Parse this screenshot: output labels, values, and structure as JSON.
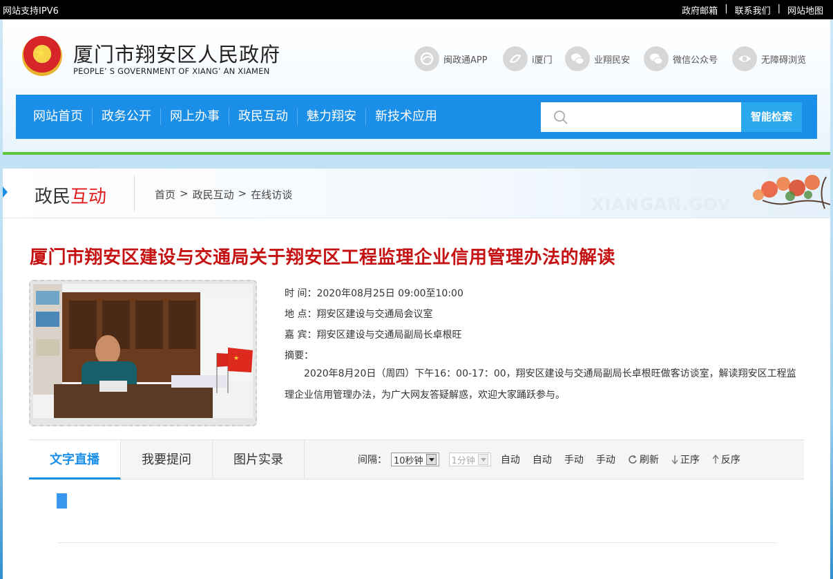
{
  "topbar": {
    "ipv6": "网站支持IPV6",
    "links": [
      "政府邮箱",
      "联系我们",
      "网站地图"
    ],
    "separator": "|"
  },
  "header": {
    "title": "厦门市翔安区人民政府",
    "subtitle": "PEOPLE’ S GOVERNMENT OF XIANG’ AN XIAMEN",
    "quick_links": [
      {
        "label": "闽政通APP",
        "icon": "minzhengtong-icon"
      },
      {
        "label": "i厦门",
        "icon": "ixiamen-icon"
      },
      {
        "label": "业翔民安",
        "icon": "wechat-icon"
      },
      {
        "label": "微信公众号",
        "icon": "wechat-icon"
      },
      {
        "label": "无障碍浏览",
        "icon": "eye-icon"
      }
    ]
  },
  "nav": {
    "items": [
      "网站首页",
      "政务公开",
      "网上办事",
      "政民互动",
      "魅力翔安",
      "新技术应用"
    ],
    "search_placeholder": "",
    "search_button": "智能检索"
  },
  "section": {
    "title_black": "政民",
    "title_red": "互动",
    "breadcrumb": [
      "首页",
      ">",
      "政民互动",
      ">",
      "在线访谈"
    ],
    "watermark": "XIANGAN.GOV"
  },
  "article": {
    "title": "厦门市翔安区建设与交通局关于翔安区工程监理企业信用管理办法的解读",
    "time": "时 间：2020年08月25日 09:00至10:00",
    "place": "地 点：翔安区建设与交通局会议室",
    "guest": "嘉 宾：翔安区建设与交通局副局长卓根旺",
    "summary_label": "摘要：",
    "summary": "2020年8月20日（周四）下午16：00-17：00，翔安区建设与交通局副局长卓根旺做客访谈室，解读翔安区工程监理企业信用管理办法，为广大网友答疑解惑，欢迎大家踊跃参与。"
  },
  "tabs": {
    "items": [
      "文字直播",
      "我要提问",
      "图片实录"
    ],
    "active": 0
  },
  "controls": {
    "interval_label": "间隔：",
    "interval_value": "10秒钟",
    "interval_value2": "1分钟",
    "buttons": [
      "自动",
      "自动",
      "手动",
      "手动"
    ],
    "refresh": "刷新",
    "asc": "正序",
    "desc": "反序"
  },
  "colors": {
    "nav_blue": "#1b8ee8",
    "title_red": "#c51111",
    "accent_green": "#5fc53a"
  }
}
